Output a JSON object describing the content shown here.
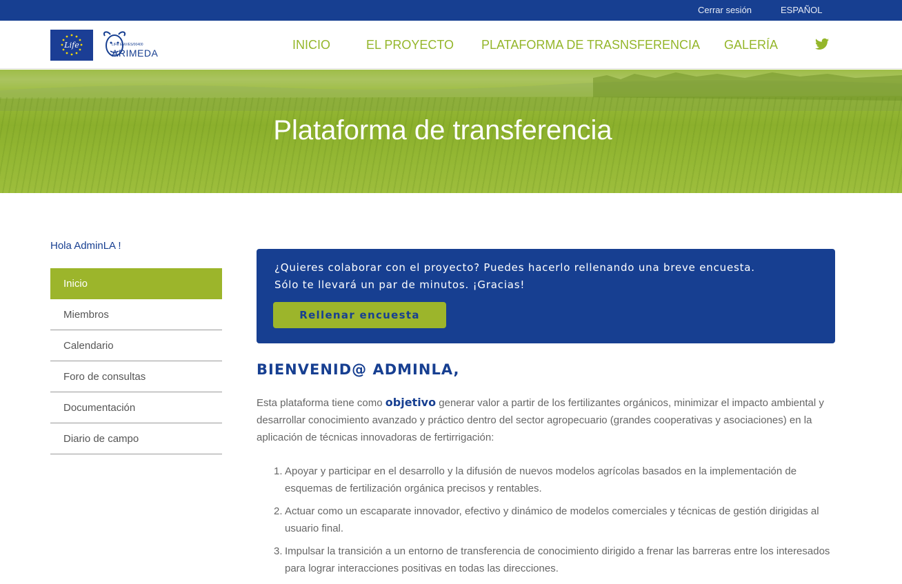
{
  "topbar": {
    "logout": "Cerrar sesión",
    "language": "ESPAÑOL"
  },
  "logo": {
    "sub": "LIFE ENV/ES/00400",
    "name": "ARIMEDA",
    "eu_text": "Life"
  },
  "nav": {
    "items": [
      "INICIO",
      "EL PROYECTO",
      "PLATAFORMA DE TRASNSFERENCIA",
      "GALERÍA"
    ]
  },
  "hero": {
    "title": "Plataforma de transferencia"
  },
  "sidebar": {
    "greeting": "Hola AdminLA !",
    "items": [
      "Inicio",
      "Miembros",
      "Calendario",
      "Foro de consultas",
      "Documentación",
      "Diario de campo"
    ],
    "active": "Inicio"
  },
  "survey": {
    "line1": "¿Quieres colaborar con el proyecto? Puedes hacerlo rellenando una breve encuesta.",
    "line2": "Sólo te llevará un par de minutos. ¡Gracias!",
    "button": "Rellenar encuesta"
  },
  "content": {
    "welcome": "BIENVENID@ ADMINLA,",
    "intro_before": "Esta plataforma tiene como ",
    "intro_keyword": "objetivo",
    "intro_after": " generar valor a partir de los fertilizantes orgánicos, minimizar el impacto ambiental y desarrollar conocimiento avanzado y práctico dentro del sector agropecuario (grandes cooperativas y asociaciones) en la aplicación de técnicas innovadoras de fertirrigación:",
    "goals": [
      "Apoyar y participar en el desarrollo y la difusión de nuevos modelos agrícolas basados en la implementación de esquemas de fertilización orgánica precisos y rentables.",
      "Actuar como un escaparate innovador, efectivo y dinámico de modelos comerciales y técnicas de gestión dirigidas al usuario final.",
      "Impulsar la transición a un entorno de transferencia de conocimiento dirigido a frenar las barreras entre los interesados para lograr interacciones positivas en todas las direcciones."
    ],
    "goal_numbers": [
      "1.",
      "2.",
      "3."
    ]
  },
  "colors": {
    "navy": "#173f91",
    "green": "#9cb52b",
    "nav_green": "#94b62a"
  }
}
